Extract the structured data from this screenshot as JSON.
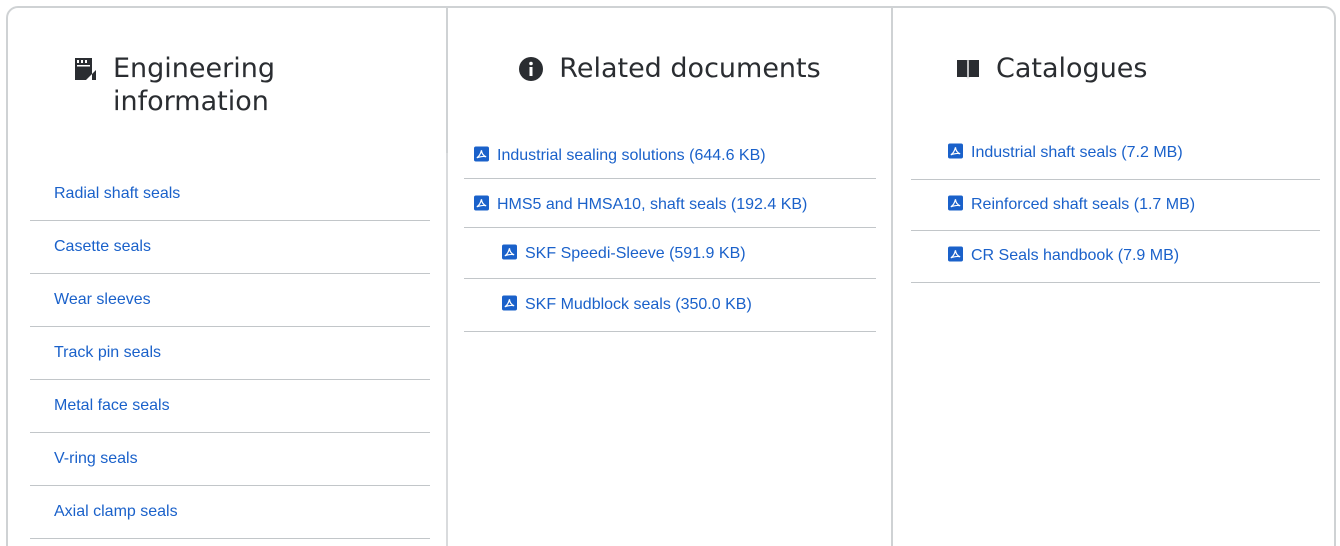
{
  "engineering": {
    "title_line1": "Engineering",
    "title_line2": "information",
    "icon": "engineering-icon",
    "links": [
      "Radial shaft seals",
      "Casette seals",
      "Wear sleeves",
      "Track pin seals",
      "Metal face seals",
      "V-ring seals",
      "Axial clamp seals"
    ]
  },
  "related": {
    "title": "Related documents",
    "icon": "info-icon",
    "docs": [
      "Industrial sealing solutions (644.6 KB)",
      "HMS5 and HMSA10, shaft seals (192.4 KB)",
      "SKF Speedi-Sleeve (591.9 KB)",
      "SKF Mudblock seals (350.0 KB)"
    ]
  },
  "catalogues": {
    "title": "Catalogues",
    "icon": "book-icon",
    "docs": [
      "Industrial shaft seals (7.2 MB)",
      "Reinforced shaft seals (1.7 MB)",
      "CR Seals handbook (7.9 MB)"
    ]
  },
  "colors": {
    "link": "#1a61ca",
    "text": "#2a2d31",
    "border": "#cfd2d4"
  }
}
